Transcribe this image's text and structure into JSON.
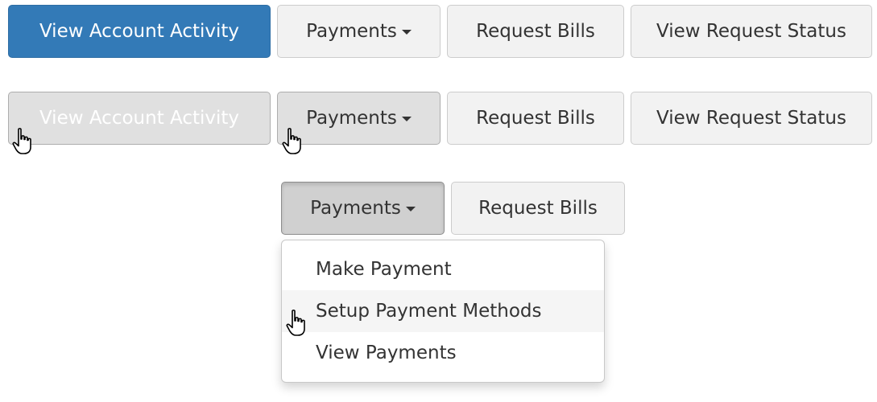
{
  "states": {
    "normal": {
      "buttons": {
        "view_account_activity": "View Account Activity",
        "payments": "Payments",
        "request_bills": "Request Bills",
        "view_request_status": "View Request Status"
      }
    },
    "hover": {
      "buttons": {
        "view_account_activity": "View Account Activity",
        "payments": "Payments",
        "request_bills": "Request Bills",
        "view_request_status": "View Request Status"
      }
    },
    "open": {
      "buttons": {
        "payments": "Payments",
        "request_bills": "Request Bills"
      },
      "dropdown": {
        "items": [
          "Make Payment",
          "Setup Payment Methods",
          "View Payments"
        ]
      }
    }
  },
  "icons": {
    "dropdown_caret": "caret-down-icon",
    "pointer": "hand-pointer-icon"
  },
  "colors": {
    "primary": "#337ab7",
    "primary_hover": "#286090",
    "default_button": "#f2f2f2",
    "default_button_hover": "#e0e0e0",
    "default_button_active": "#d0d0d0"
  }
}
